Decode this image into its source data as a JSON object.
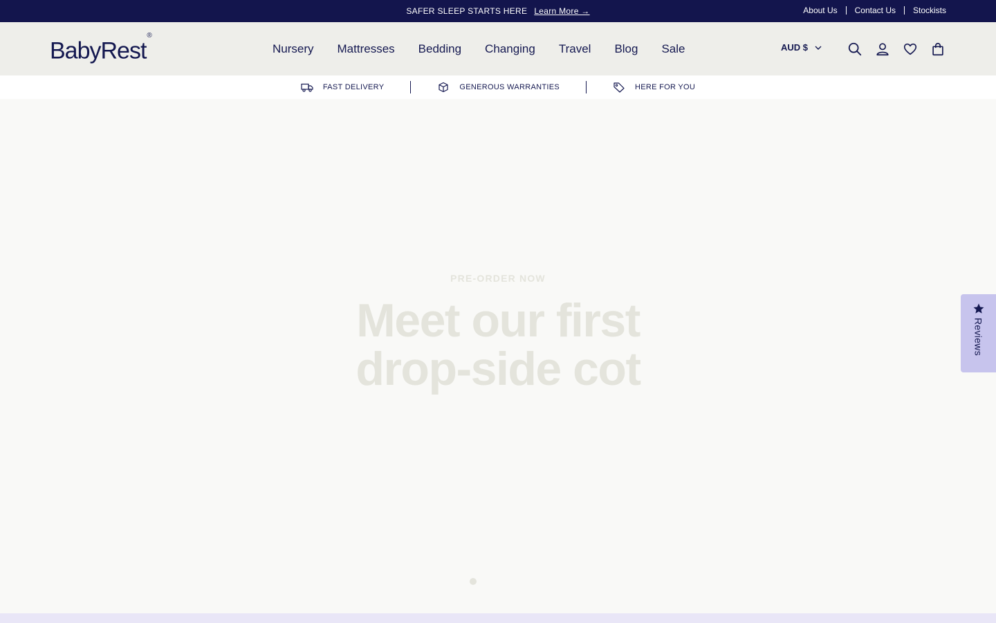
{
  "announcement": {
    "text": "SAFER SLEEP STARTS HERE",
    "link": "Learn More →",
    "links": [
      "About Us",
      "Contact Us",
      "Stockists"
    ]
  },
  "header": {
    "logo": "BabyRest",
    "logo_mark": "®",
    "nav": [
      "Nursery",
      "Mattresses",
      "Bedding",
      "Changing",
      "Travel",
      "Blog",
      "Sale"
    ],
    "currency": "AUD $",
    "icons": [
      "search-icon",
      "account-icon",
      "wishlist-heart-icon",
      "cart-bag-icon"
    ]
  },
  "features": [
    {
      "icon": "truck-icon",
      "label": "FAST DELIVERY"
    },
    {
      "icon": "box-icon",
      "label": "GENEROUS WARRANTIES"
    },
    {
      "icon": "tag-icon",
      "label": "HERE FOR YOU"
    }
  ],
  "hero": {
    "eyebrow": "PRE-ORDER NOW",
    "title_line1": "Meet our first",
    "title_line2": "drop-side cot",
    "slide_count": 1
  },
  "reviews_tab": {
    "label": "Reviews"
  },
  "colors": {
    "brand_navy": "#13154d",
    "header_bg": "#eeeeea",
    "hero_bg": "#f9f9f7",
    "reviews_tab": "#c7c4ed"
  }
}
